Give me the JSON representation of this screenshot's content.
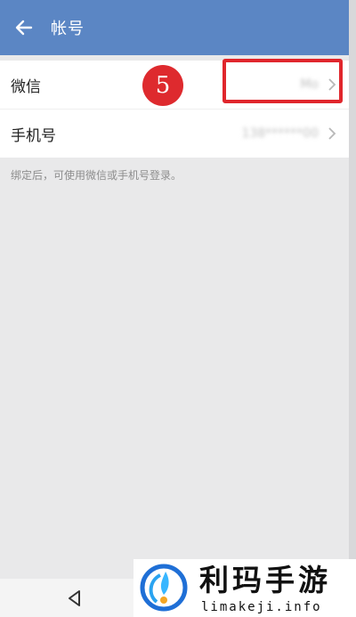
{
  "header": {
    "title": "帐号",
    "back_icon": "arrow-left-icon",
    "background": "#5b86c4"
  },
  "rows": [
    {
      "label": "微信",
      "value": "Mo",
      "chevron_icon": "chevron-right-icon"
    },
    {
      "label": "手机号",
      "value": "138******00",
      "chevron_icon": "chevron-right-icon"
    }
  ],
  "hint": "绑定后，可使用微信或手机号登录。",
  "annotation": {
    "step_number": "5",
    "color": "#de2a2e"
  },
  "navigation": {
    "back_icon": "triangle-back-icon"
  },
  "watermark": {
    "brand": "利玛手游",
    "url": "limakeji.info"
  }
}
